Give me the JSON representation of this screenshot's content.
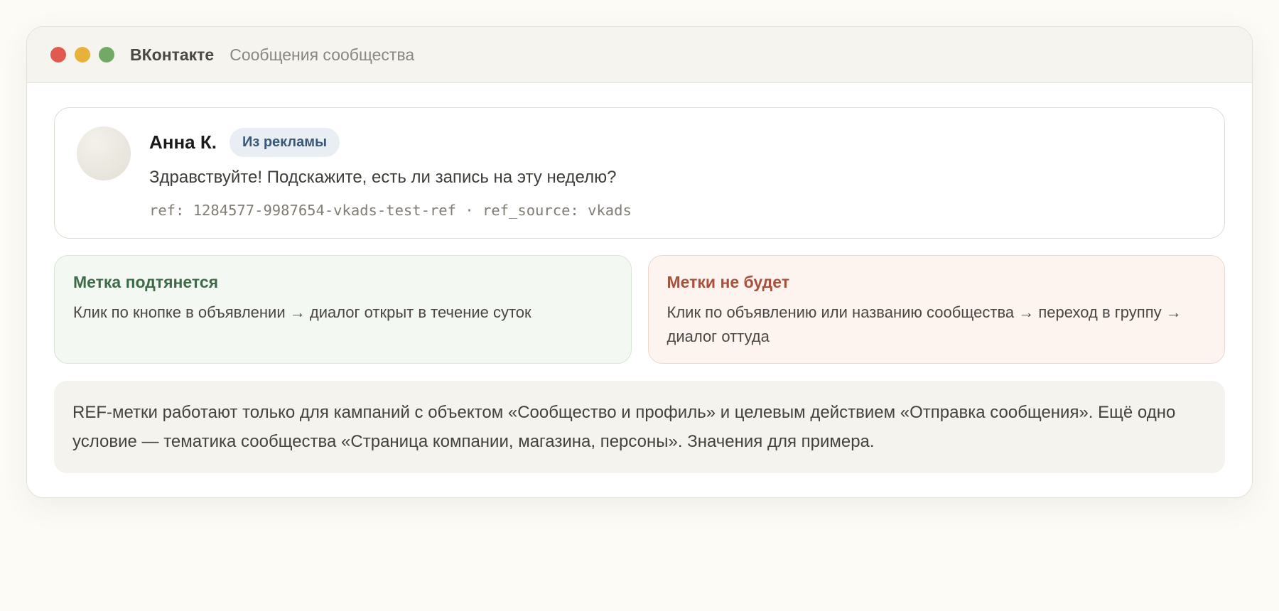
{
  "window": {
    "app_name": "ВКонтакте",
    "subtitle": "Сообщения сообщества"
  },
  "message": {
    "author": "Анна К.",
    "badge": "Из рекламы",
    "text": "Здравствуйте! Подскажите, есть ли запись на эту неделю?",
    "ref_line": "ref: 1284577-9987654-vkads-test-ref · ref_source: vkads"
  },
  "cards": {
    "ok": {
      "title": "Метка подтянется",
      "text": "Клик по кнопке в объявлении → диалог открыт в течение суток"
    },
    "bad": {
      "title": "Метки не будет",
      "text": "Клик по объявлению или названию сообщества → переход в группу → диалог оттуда"
    }
  },
  "note": {
    "text": "REF-метки работают только для кампаний с объектом «Сообщество и профиль» и целевым действием «Отправка сообщения». Ещё одно условие — тематика сообщества «Страница компании, магазина, персоны». Значения для примера."
  },
  "colors": {
    "close": "#e05a4f",
    "minimize": "#e8b13a",
    "maximize": "#72aa65",
    "ok_title": "#3d6b47",
    "bad_title": "#a9503a",
    "badge_text": "#3a5978"
  }
}
